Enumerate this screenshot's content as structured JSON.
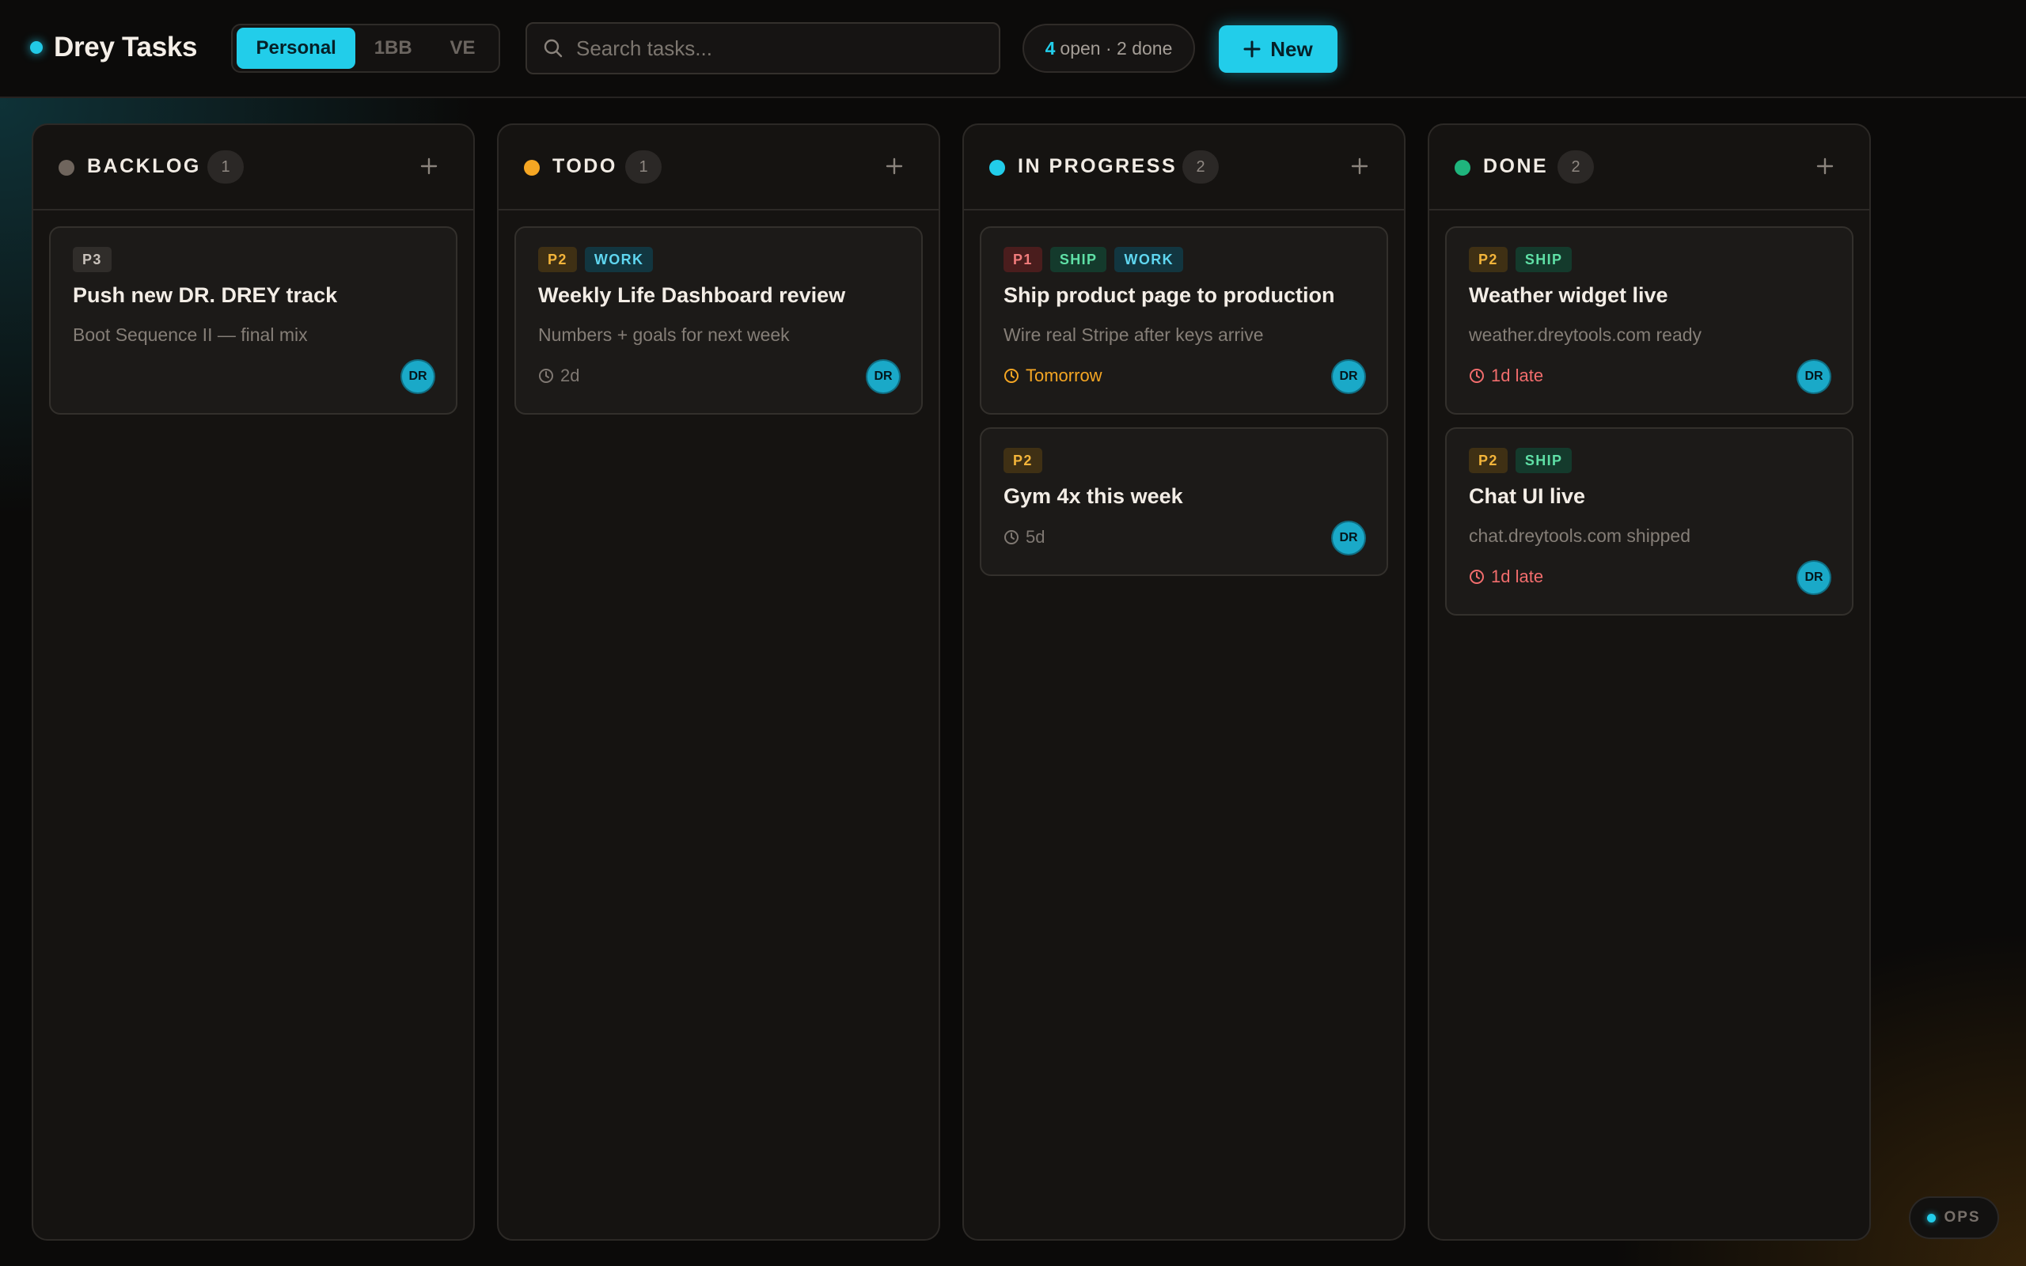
{
  "app": {
    "title": "Drey Tasks",
    "accent_color": "#22cdea"
  },
  "workspaces": {
    "items": [
      "Personal",
      "1BB",
      "VE"
    ],
    "active": "Personal"
  },
  "search": {
    "placeholder": "Search tasks...",
    "value": ""
  },
  "stats": {
    "open_count": "4",
    "open_label": "open · 2 done"
  },
  "toolbar": {
    "new_label": "New"
  },
  "columns": [
    {
      "title": "BACKLOG",
      "count": "1",
      "dot_color": "#6f655d",
      "cards": [
        {
          "tags": [
            "P3"
          ],
          "title": "Push new DR. DREY track",
          "desc": "Boot Sequence II — final mix",
          "due": "",
          "avatar": "DR"
        }
      ]
    },
    {
      "title": "TODO",
      "count": "1",
      "dot_color": "#f5a623",
      "cards": [
        {
          "tags": [
            "P2",
            "WORK"
          ],
          "title": "Weekly Life Dashboard review",
          "desc": "Numbers + goals for next week",
          "due": "2d",
          "avatar": "DR"
        }
      ]
    },
    {
      "title": "IN PROGRESS",
      "count": "2",
      "dot_color": "#22cdea",
      "cards": [
        {
          "tags": [
            "P1",
            "SHIP",
            "WORK"
          ],
          "title": "Ship product page to production",
          "desc": "Wire real Stripe after keys arrive",
          "due": "Tomorrow",
          "avatar": "DR"
        },
        {
          "tags": [
            "P2"
          ],
          "title": "Gym 4x this week",
          "desc": "",
          "due": "5d",
          "avatar": "DR"
        }
      ]
    },
    {
      "title": "DONE",
      "count": "2",
      "dot_color": "#1fb57d",
      "cards": [
        {
          "tags": [
            "P2",
            "SHIP"
          ],
          "title": "Weather widget live",
          "desc": "weather.dreytools.com ready",
          "due": "1d late",
          "avatar": "DR"
        },
        {
          "tags": [
            "P2",
            "SHIP"
          ],
          "title": "Chat UI live",
          "desc": "chat.dreytools.com shipped",
          "due": "1d late",
          "avatar": "DR"
        }
      ]
    }
  ],
  "ops": {
    "label": "OPS"
  },
  "icons": {
    "brand": "status-dot-icon",
    "search": "search-icon",
    "new": "plus-icon",
    "column_add": "plus-icon",
    "due": "clock-icon"
  }
}
